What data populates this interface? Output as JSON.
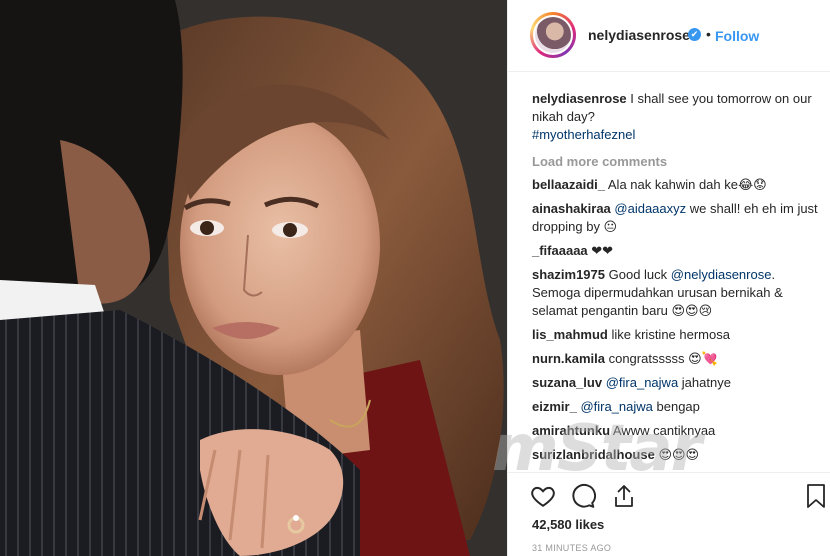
{
  "post": {
    "username": "nelydiasenrose",
    "verified_mark": "✔",
    "separator": "•",
    "follow_label": "Follow",
    "caption_text": "I shall see you tomorrow on our nikah day?",
    "hashtag": "#myotherhafeznel",
    "load_more": "Load more comments",
    "likes": "42,580 likes",
    "time": "31 MINUTES AGO",
    "watermark": "mStar"
  },
  "comments": [
    {
      "user": "bellaazaidi_",
      "text": "Ala nak kahwin dah ke😂😟"
    },
    {
      "user": "ainashakiraa",
      "mention": "@aidaaaxyz",
      "text": "we shall! eh eh im just dropping by 😐"
    },
    {
      "user": "_fifaaaaa",
      "text": "❤❤"
    },
    {
      "user": "shazim1975",
      "pre": "Good luck",
      "mention": "@nelydiasenrose",
      "text": ". Semoga dipermudahkan urusan bernikah & selamat pengantin baru 😍😍😢"
    },
    {
      "user": "lis_mahmud",
      "text": "like kristine hermosa"
    },
    {
      "user": "nurn.kamila",
      "text": "congratsssss 😍💘"
    },
    {
      "user": "suzana_luv",
      "mention": "@fira_najwa",
      "text": "jahatnye"
    },
    {
      "user": "eizmir_",
      "mention": "@fira_najwa",
      "text": "bengap"
    },
    {
      "user": "amirahtunku",
      "text": "Awww cantiknyaa"
    },
    {
      "user": "surizlanbridalhouse",
      "text": "😍😍😍"
    }
  ],
  "icons": {
    "like": "heart-icon",
    "comment": "comment-icon",
    "share": "share-icon",
    "save": "bookmark-icon"
  },
  "colors": {
    "link": "#003569",
    "follow": "#3897f0",
    "muted": "#999999"
  }
}
